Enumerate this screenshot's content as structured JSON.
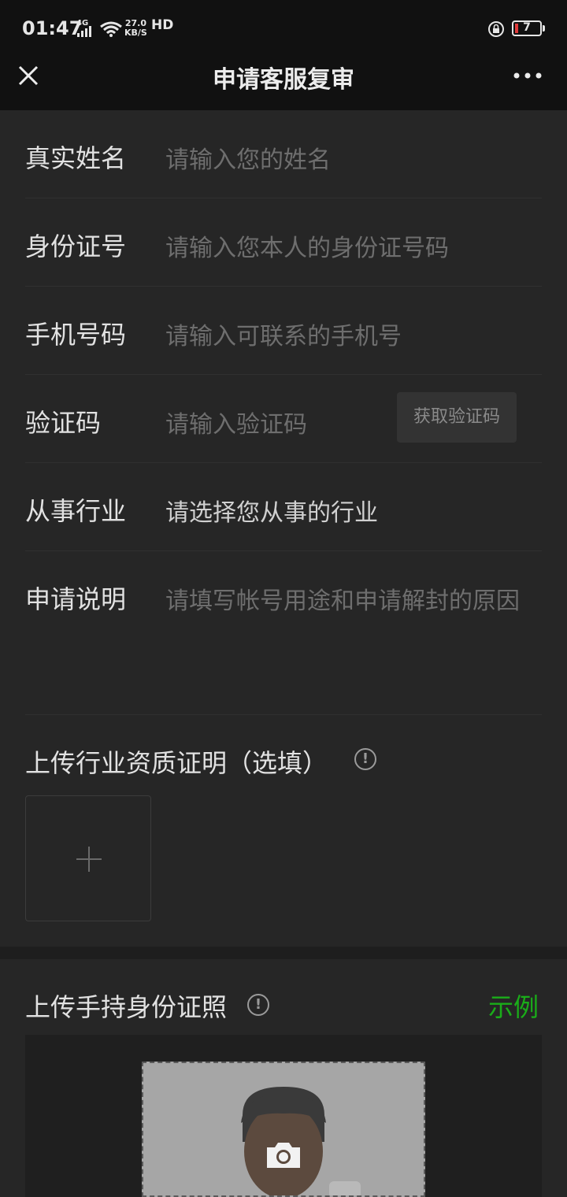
{
  "status_bar": {
    "time": "01:47",
    "network": "4G",
    "speed_value": "27.0",
    "speed_unit": "KB/S",
    "hd": "HD",
    "battery": "7",
    "battery_color": "#e03b3b"
  },
  "nav": {
    "title": "申请客服复审",
    "close_icon": "close-icon",
    "more_icon": "more-icon"
  },
  "form": {
    "name": {
      "label": "真实姓名",
      "placeholder": "请输入您的姓名"
    },
    "id_number": {
      "label": "身份证号",
      "placeholder": "请输入您本人的身份证号码"
    },
    "phone": {
      "label": "手机号码",
      "placeholder": "请输入可联系的手机号"
    },
    "code": {
      "label": "验证码",
      "placeholder": "请输入验证码",
      "button": "获取验证码"
    },
    "industry": {
      "label": "从事行业",
      "value": "请选择您从事的行业"
    },
    "description": {
      "label": "申请说明",
      "placeholder": "请填写帐号用途和申请解封的原因"
    }
  },
  "qualification": {
    "title": "上传行业资质证明（选填）",
    "info_icon": "info-icon",
    "upload_icon": "plus-icon"
  },
  "id_photo": {
    "title": "上传手持身份证照",
    "info_icon": "info-icon",
    "example_label": "示例",
    "example_color": "#1aad19",
    "camera_icon": "camera-icon"
  }
}
